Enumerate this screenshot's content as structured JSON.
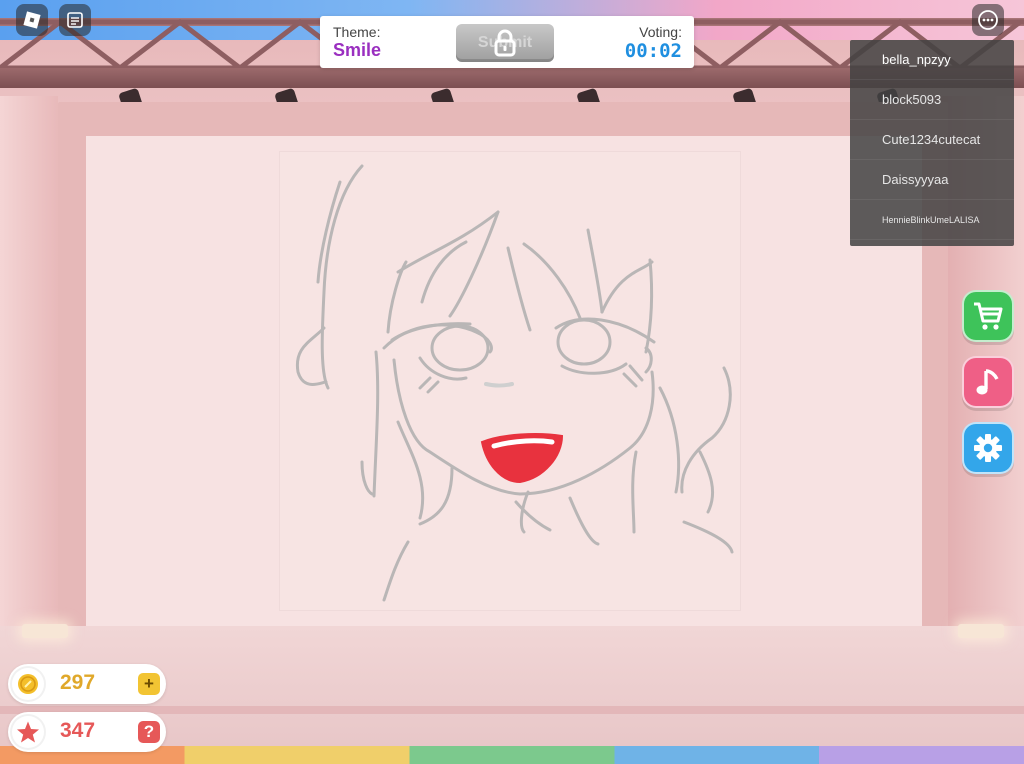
{
  "hud": {
    "theme_label": "Theme:",
    "theme_value": "Smile",
    "theme_color": "#9a2fc0",
    "voting_label": "Voting:",
    "voting_time": "00:02",
    "voting_color": "#1f8fe0",
    "submit_label": "Submit",
    "submit_locked": true
  },
  "players": [
    {
      "name": "bella_npzyy"
    },
    {
      "name": "block5093"
    },
    {
      "name": "Cute1234cutecat"
    },
    {
      "name": "Daissyyyaa"
    },
    {
      "name": "HennieBlinkUmeLALISA"
    }
  ],
  "side_buttons": [
    {
      "icon": "cart-icon",
      "color": "#3ec35a"
    },
    {
      "icon": "music-note-icon",
      "color": "#ef5f86"
    },
    {
      "icon": "gear-icon",
      "color": "#33a6ea"
    }
  ],
  "currency": {
    "coins": "297",
    "coins_color": "#e0a82a",
    "coins_action": "+",
    "stars": "347",
    "stars_color": "#e65858",
    "stars_action": "?"
  }
}
